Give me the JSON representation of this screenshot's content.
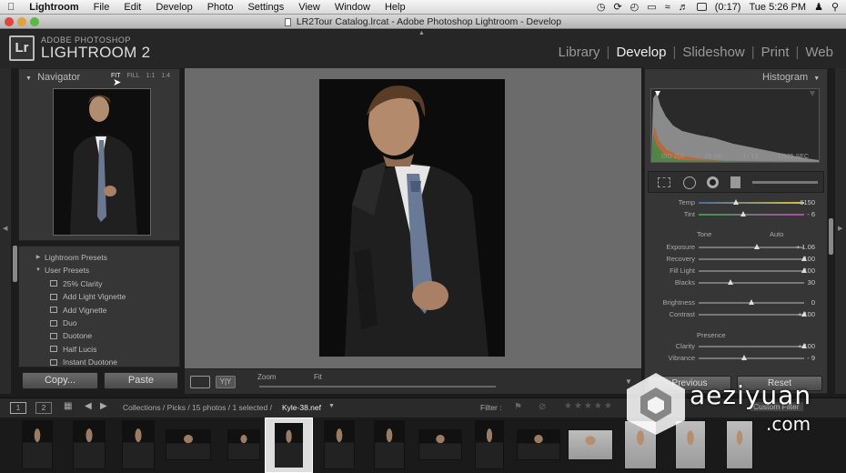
{
  "menubar": {
    "app_name": "Lightroom",
    "items": [
      "File",
      "Edit",
      "Develop",
      "Photo",
      "Settings",
      "View",
      "Window",
      "Help"
    ],
    "battery": "(0:17)",
    "clock": "Tue 5:26 PM"
  },
  "window": {
    "title": "LR2Tour Catalog.lrcat - Adobe Photoshop Lightroom - Develop"
  },
  "brand": {
    "logo": "Lr",
    "top": "ADOBE PHOTOSHOP",
    "main": "LIGHTROOM 2"
  },
  "modules": [
    "Library",
    "Develop",
    "Slideshow",
    "Print",
    "Web"
  ],
  "active_module": "Develop",
  "navigator": {
    "title": "Navigator",
    "options": [
      "FIT",
      "FILL",
      "1:1",
      "1:4"
    ]
  },
  "presets": {
    "groups": [
      "Lightroom Presets",
      "User Presets"
    ],
    "items": [
      "25% Clarity",
      "Add Light Vignette",
      "Add Vignette",
      "Duo",
      "Duotone",
      "Half Lucis",
      "Instant Duotone"
    ]
  },
  "buttons": {
    "copy": "Copy...",
    "paste": "Paste",
    "previous": "Previous",
    "reset": "Reset"
  },
  "toolbar": {
    "zoom": "Zoom",
    "fit": "Fit"
  },
  "histogram": {
    "title": "Histogram",
    "iso": "ISO 200",
    "focal": "95 mm",
    "aperture": "f / 13",
    "shutter": "1/125 SEC"
  },
  "develop": {
    "wb": [
      {
        "label": "Temp",
        "value": "6150",
        "pos": 0.35
      },
      {
        "label": "Tint",
        "value": "- 6",
        "pos": 0.42
      }
    ],
    "tone_title": "Tone",
    "auto": "Auto",
    "tone": [
      {
        "label": "Exposure",
        "value": "+ 1.06",
        "pos": 0.55
      },
      {
        "label": "Recovery",
        "value": "100",
        "pos": 1.0
      },
      {
        "label": "Fill Light",
        "value": "100",
        "pos": 1.0
      },
      {
        "label": "Blacks",
        "value": "30",
        "pos": 0.3
      },
      {
        "label": "Brightness",
        "value": "0",
        "pos": 0.5
      },
      {
        "label": "Contrast",
        "value": "+ 100",
        "pos": 1.0
      }
    ],
    "presence_title": "Presence",
    "presence": [
      {
        "label": "Clarity",
        "value": "+ 100",
        "pos": 1.0
      },
      {
        "label": "Vibrance",
        "value": "- 9",
        "pos": 0.43
      }
    ]
  },
  "filmstrip": {
    "pages": [
      "1",
      "2"
    ],
    "path": "Collections / Picks / 15 photos / 1 selected /",
    "filename": "Kyle-38.nef",
    "filter": "Filter :",
    "custom_filter": "Custom Filter"
  },
  "watermark": {
    "name": "aeziyuan",
    "tld": ".com"
  },
  "colors": {
    "accent": "#e8e8e8",
    "panel": "#363636",
    "center": "#6b6b6b"
  }
}
